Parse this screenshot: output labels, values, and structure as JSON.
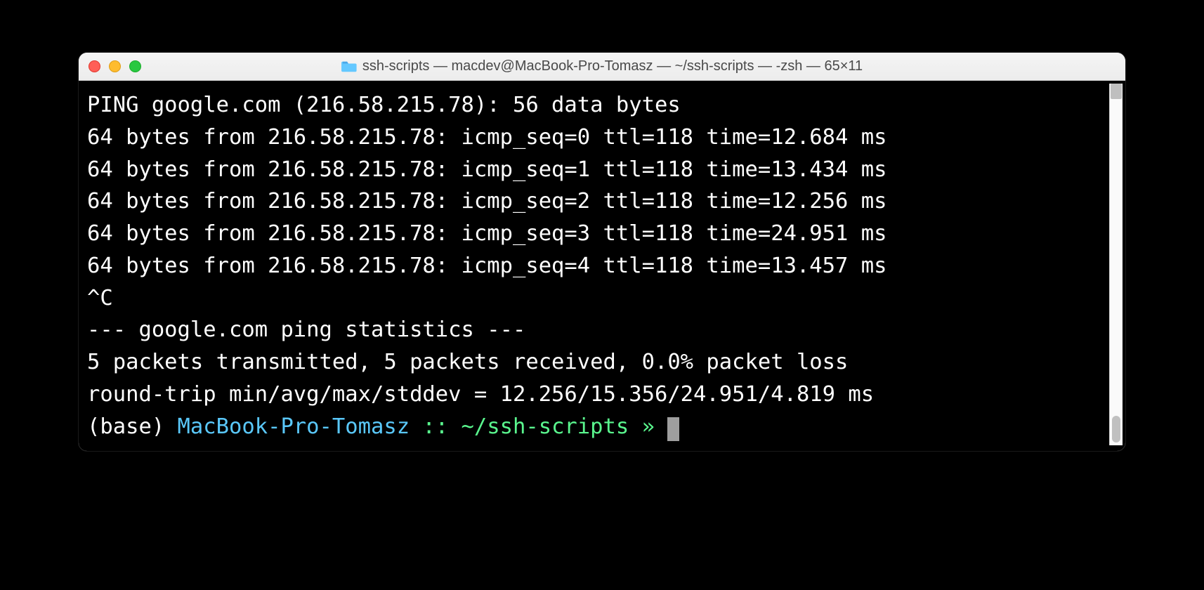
{
  "window": {
    "title": "ssh-scripts — macdev@MacBook-Pro-Tomasz — ~/ssh-scripts — -zsh — 65×11"
  },
  "output": {
    "lines": [
      "PING google.com (216.58.215.78): 56 data bytes",
      "64 bytes from 216.58.215.78: icmp_seq=0 ttl=118 time=12.684 ms",
      "64 bytes from 216.58.215.78: icmp_seq=1 ttl=118 time=13.434 ms",
      "64 bytes from 216.58.215.78: icmp_seq=2 ttl=118 time=12.256 ms",
      "64 bytes from 216.58.215.78: icmp_seq=3 ttl=118 time=24.951 ms",
      "64 bytes from 216.58.215.78: icmp_seq=4 ttl=118 time=13.457 ms",
      "^C",
      "--- google.com ping statistics ---",
      "5 packets transmitted, 5 packets received, 0.0% packet loss",
      "round-trip min/avg/max/stddev = 12.256/15.356/24.951/4.819 ms"
    ]
  },
  "prompt": {
    "base": "(base) ",
    "host": "MacBook-Pro-Tomasz",
    "sep": " :: ",
    "path": "~/ssh-scripts",
    "arrow": " » "
  }
}
